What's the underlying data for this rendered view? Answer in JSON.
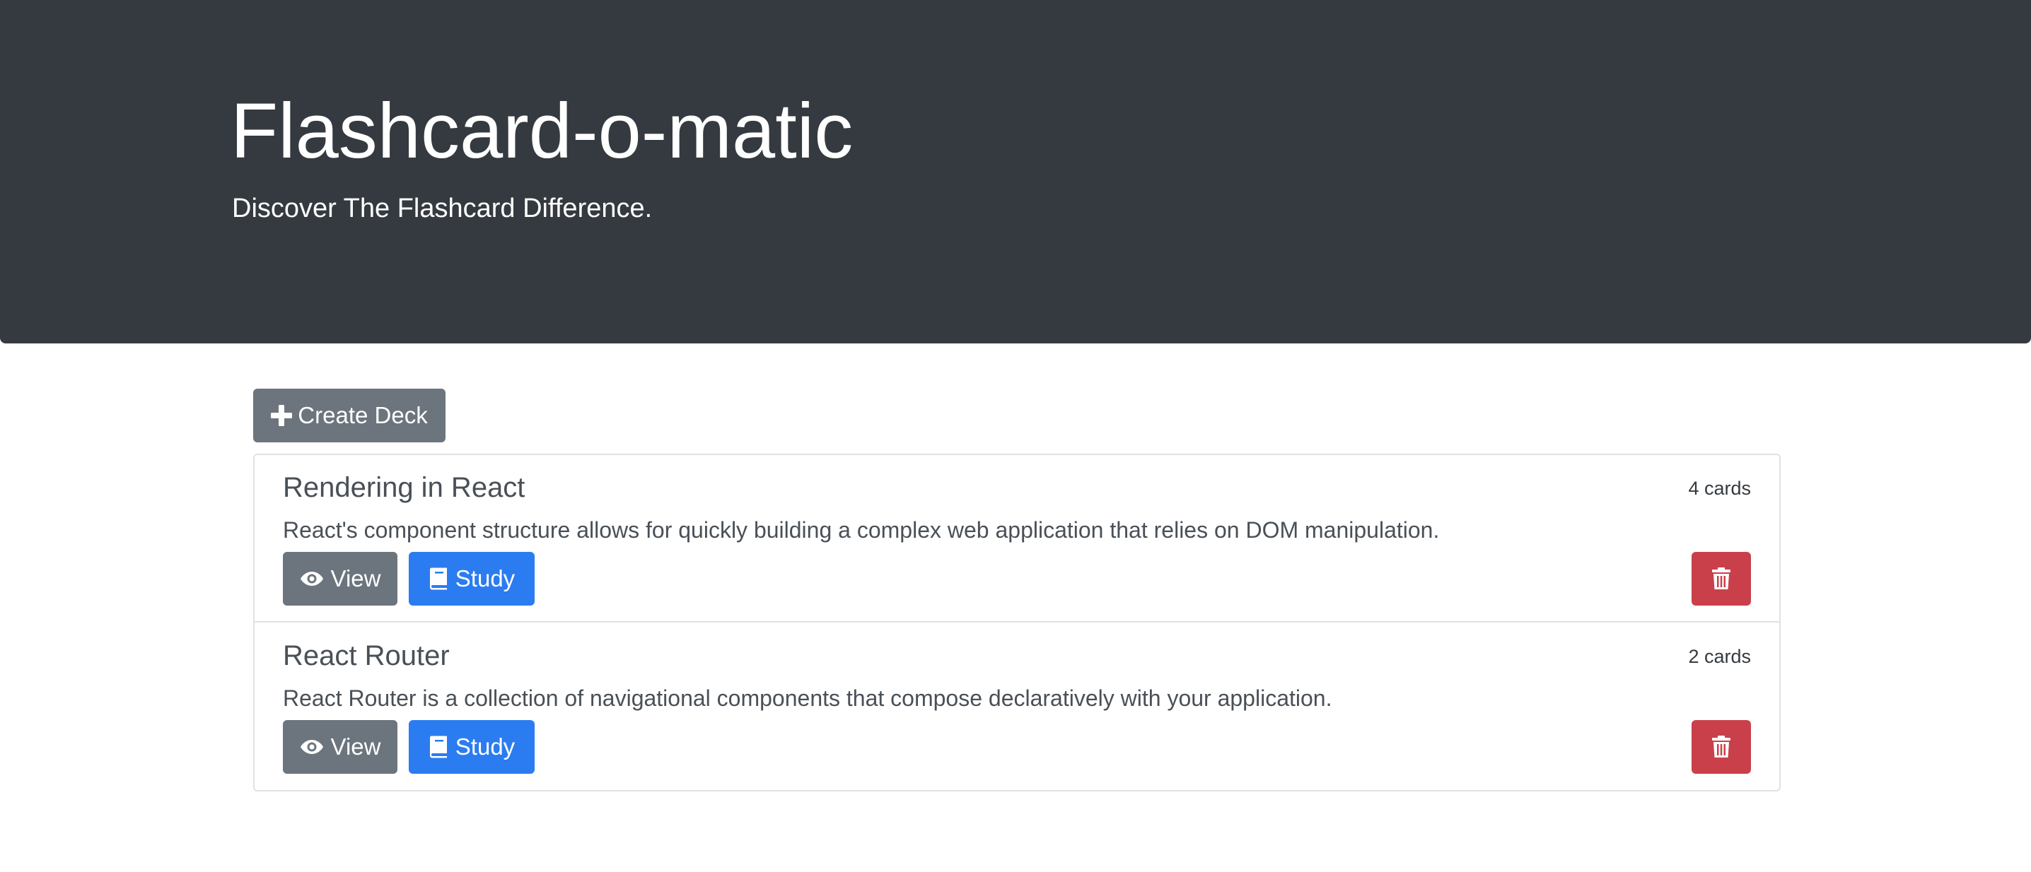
{
  "header": {
    "title": "Flashcard-o-matic",
    "subtitle": "Discover The Flashcard Difference."
  },
  "toolbar": {
    "create_label": "Create Deck",
    "create_icon": "plus-icon"
  },
  "decks": [
    {
      "name": "Rendering in React",
      "count": "4 cards",
      "description": "React's component structure allows for quickly building a complex web application that relies on DOM manipulation.",
      "view_label": "View",
      "study_label": "Study"
    },
    {
      "name": "React Router",
      "count": "2 cards",
      "description": "React Router is a collection of navigational components that compose declaratively with your application.",
      "view_label": "View",
      "study_label": "Study"
    }
  ],
  "icons": {
    "view": "eye-icon",
    "study": "book-icon",
    "delete": "trash-icon"
  },
  "colors": {
    "header_bg": "#343a40",
    "secondary": "#6c757d",
    "primary": "#2b7cf0",
    "danger": "#c9404b"
  }
}
